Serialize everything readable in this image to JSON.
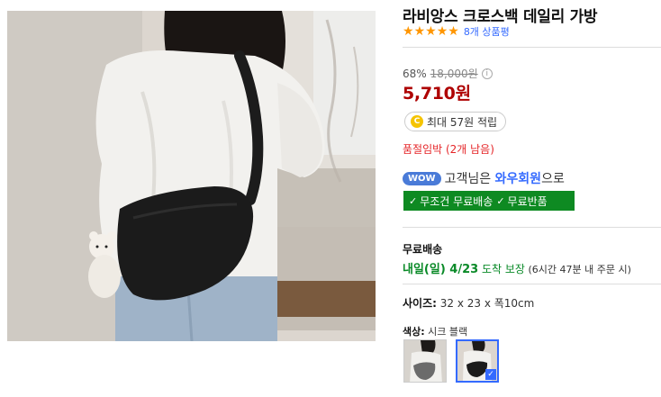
{
  "product": {
    "title": "라비앙스 크로스백 데일리 가방",
    "rating_stars": 5,
    "review_count_text": "8개 상품평",
    "discount_rate": "68%",
    "original_price": "18,000원",
    "info_icon_glyph": "i",
    "sale_price": "5,710원",
    "stock_warning": "품절임박 (2개 남음)"
  },
  "cashback": {
    "coin_glyph": "C",
    "text": "최대 57원 적립"
  },
  "wow": {
    "badge": "WOW",
    "prefix": "고객님은 ",
    "member": "와우회원",
    "suffix": "으로"
  },
  "benefits": [
    {
      "icon": "check-icon",
      "glyph": "✓",
      "label": "무조건 무료배송"
    },
    {
      "icon": "check-icon",
      "glyph": "✓",
      "label": "무료반품"
    }
  ],
  "shipping": {
    "label": "무료배송",
    "arrival_date": "내일(일) 4/23",
    "arrival_guarantee": " 도착 보장",
    "arrival_note": " (6시간 47분 내 주문 시)"
  },
  "options": {
    "size_label": "사이즈:",
    "size_value": " 32 x 23 x 폭10cm",
    "color_label": "색상:",
    "color_value": " 시크 블랙",
    "swatches": [
      {
        "name": "swatch-1",
        "selected": false
      },
      {
        "name": "swatch-2",
        "selected": true,
        "check_glyph": "✓"
      }
    ]
  },
  "stars": {
    "glyph": "★"
  },
  "colors": {
    "price_red": "#ae0000",
    "link_blue": "#346aff",
    "star_orange": "#ff9600",
    "benefit_green": "#0e8a22",
    "warning_red": "#e52528"
  }
}
